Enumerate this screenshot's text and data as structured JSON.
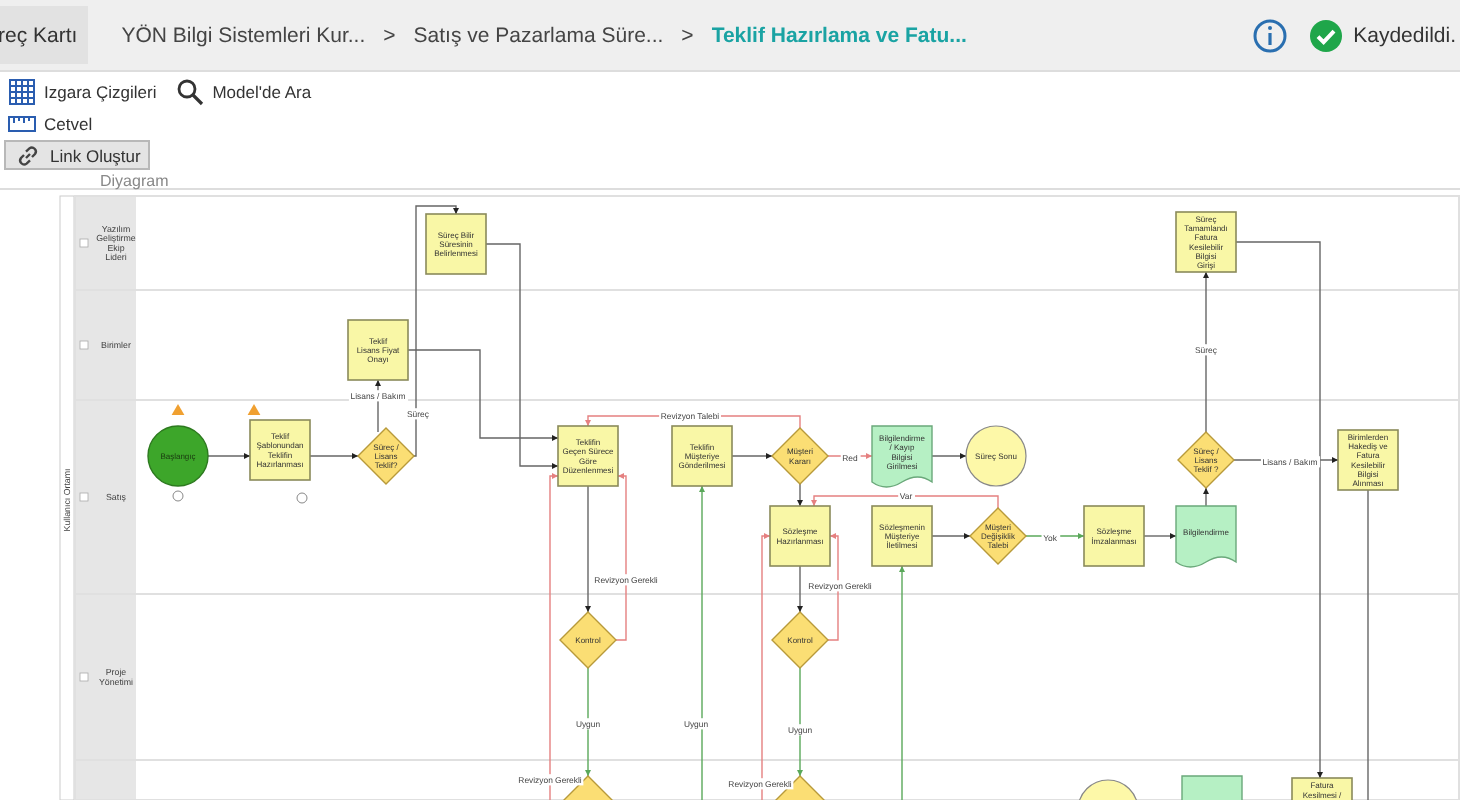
{
  "header": {
    "tab": "reç Kartı",
    "breadcrumbs": [
      {
        "kind": "crumb",
        "label": "YÖN Bilgi Sistemleri Kur...",
        "selected": false
      },
      {
        "kind": "separator",
        "label": ">"
      },
      {
        "kind": "crumb",
        "label": "Satış ve Pazarlama Süre...",
        "selected": false
      },
      {
        "kind": "separator",
        "label": ">"
      },
      {
        "kind": "crumb",
        "label": "Teklif Hazırlama ve Fatu...",
        "selected": true
      }
    ],
    "status": "Kaydedildi."
  },
  "toolbar": {
    "items": [
      {
        "kind": "grid",
        "label": "Izgara Çizgileri",
        "on": false
      },
      {
        "kind": "search",
        "label": "Model'de Ara",
        "on": false
      },
      {
        "kind": "ruler",
        "label": "Cetvel",
        "on": false
      },
      {
        "kind": "link",
        "label": "Link Oluştur",
        "on": true
      }
    ],
    "section": "Diyagram"
  },
  "diagram": {
    "pool": "Kullanıcı Ortamı",
    "lanes": [
      {
        "label": "Yazılım Geliştirme Ekip Lideri"
      },
      {
        "label": "Birimler"
      },
      {
        "label": "Satış"
      },
      {
        "label": "Proje Yönetimi"
      }
    ],
    "nodes": [
      {
        "kind": "task",
        "label": "Süreç Bilir Süresinin Belirlenmesi"
      },
      {
        "kind": "task",
        "label": "Süreç Tamamlandı Fatura Kesilebilir Bilgisi Girişi"
      },
      {
        "kind": "task",
        "label": "Teklif Lisans Fiyat Onayı"
      },
      {
        "kind": "start",
        "label": "Başlangıç"
      },
      {
        "kind": "task",
        "label": "Teklif Şablonundan Teklifin Hazırlanması"
      },
      {
        "kind": "gateway",
        "label": "Süreç / Lisans Teklif?"
      },
      {
        "kind": "task",
        "label": "Teklifin Geçen Sürece Göre Düzenlenmesi"
      },
      {
        "kind": "task",
        "label": "Teklifin Müşteriye Gönderilmesi"
      },
      {
        "kind": "gateway",
        "label": "Müşteri Kararı"
      },
      {
        "kind": "document",
        "label": "Bilgilendirme / Kayıp Bilgisi Girilmesi"
      },
      {
        "kind": "end",
        "label": "Süreç Sonu"
      },
      {
        "kind": "gateway",
        "label": "Süreç / Lisans Teklif ?"
      },
      {
        "kind": "task",
        "label": "Birimlerden Hakediş ve Fatura Kesilebilir Bilgisi Alınması"
      },
      {
        "kind": "task",
        "label": "Sözleşme Hazırlanması"
      },
      {
        "kind": "task",
        "label": "Sözleşmenin Müşteriye İletilmesi"
      },
      {
        "kind": "gateway",
        "label": "Müşteri Değişiklik Talebi"
      },
      {
        "kind": "task",
        "label": "Sözleşme İmzalanması"
      },
      {
        "kind": "document",
        "label": "Bilgilendirme"
      },
      {
        "kind": "gateway",
        "label": "Kontrol"
      },
      {
        "kind": "gateway",
        "label": "Kontrol"
      },
      {
        "kind": "gateway"
      },
      {
        "kind": "gateway"
      },
      {
        "kind": "end"
      },
      {
        "kind": "document"
      },
      {
        "kind": "task",
        "label": "Fatura Kesilmesi /"
      }
    ],
    "edge_labels": [
      "Lisans / Bakım",
      "Süreç",
      "Revizyon Talebi",
      "Red",
      "Var",
      "Yok",
      "Süreç",
      "Lisans / Bakım",
      "Revizyon Gerekli",
      "Revizyon Gerekli",
      "Uygun",
      "Uygun",
      "Uygun",
      "Revizyon Gerekli",
      "Revizyon Gerekli"
    ]
  }
}
